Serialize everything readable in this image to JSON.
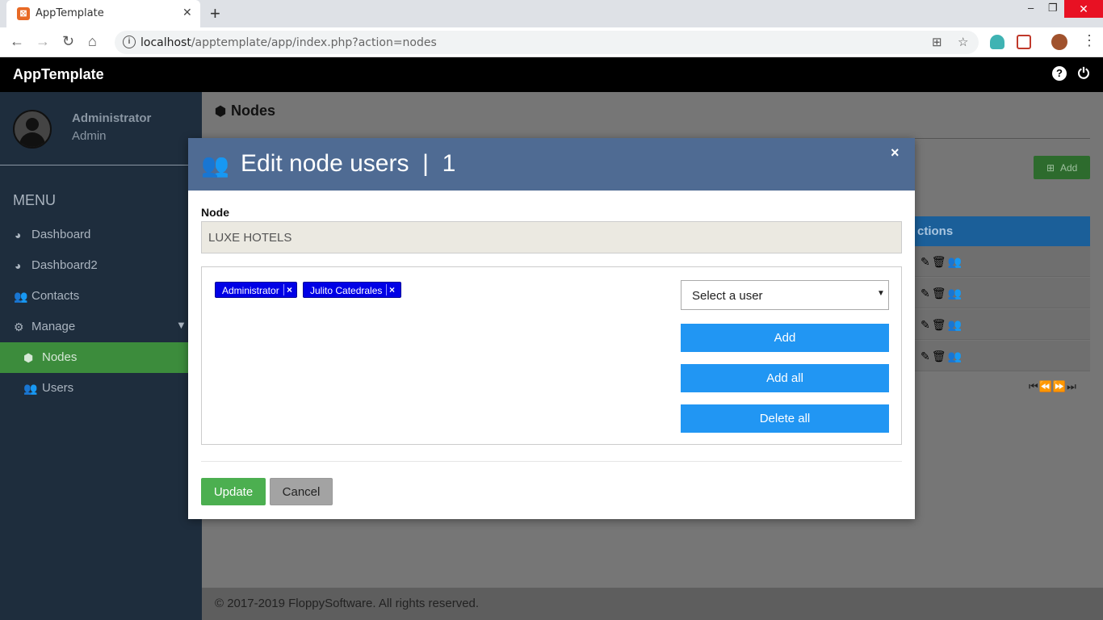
{
  "browser": {
    "tab_title": "AppTemplate",
    "tab_close": "✕",
    "new_tab": "+",
    "url_host": "localhost",
    "url_path": "/apptemplate/app/index.php?action=nodes",
    "controls": {
      "minimize": "–",
      "restore": "❐",
      "close": "✕"
    }
  },
  "app": {
    "title": "AppTemplate",
    "help_icon": "?",
    "power_icon": "⏻"
  },
  "sidebar": {
    "user_name": "Administrator",
    "user_role": "Admin",
    "menu_label": "MENU",
    "items": [
      {
        "label": "Dashboard",
        "icon": "tachometer-icon"
      },
      {
        "label": "Dashboard2",
        "icon": "tachometer-icon"
      },
      {
        "label": "Contacts",
        "icon": "users-icon"
      },
      {
        "label": "Manage",
        "icon": "cogs-icon"
      },
      {
        "label": "Nodes",
        "icon": "cubes-icon",
        "active": true
      },
      {
        "label": "Users",
        "icon": "users-icon"
      }
    ]
  },
  "page": {
    "title": "Nodes",
    "add_label": "Add",
    "table_header": "ctions",
    "footer": "© 2017-2019 FloppySoftware. All rights reserved."
  },
  "modal": {
    "title": "Edit node users  |  1",
    "close": "×",
    "node_label": "Node",
    "node_value": "LUXE HOTELS",
    "selected_users": [
      "Administrator",
      "Julito Catedrales"
    ],
    "chip_remove": "×",
    "select_placeholder": "Select a user",
    "add_label": "Add",
    "add_all_label": "Add all",
    "delete_all_label": "Delete all",
    "update_label": "Update",
    "cancel_label": "Cancel"
  },
  "colors": {
    "header_bg": "#000000",
    "sidebar_bg": "#1e2d3d",
    "active_item": "#3c8c3c",
    "modal_header": "#4f6b93",
    "primary_btn": "#2196f3",
    "update_btn": "#4caf50",
    "chip_bg": "#0000e6"
  }
}
